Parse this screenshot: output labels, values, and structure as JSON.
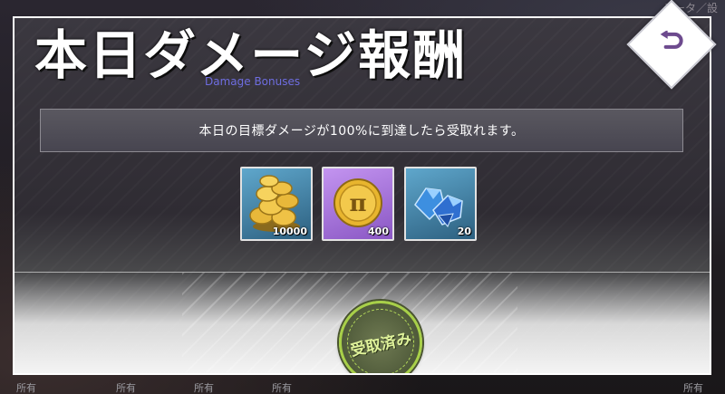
{
  "background": {
    "corner_text": "データ／設",
    "bottom_tabs": [
      "所有",
      "所有",
      "所有",
      "所有",
      "所有"
    ]
  },
  "modal": {
    "title": "本日ダメージ報酬",
    "subtitle": "Damage Bonuses",
    "notice": "本日の目標ダメージが100%に到達したら受取れます。",
    "back_button_icon": "return-arrow-icon",
    "rewards": [
      {
        "icon": "gold-coins-icon",
        "count": "10000"
      },
      {
        "icon": "pi-token-icon",
        "count": "400"
      },
      {
        "icon": "blue-gems-icon",
        "count": "20"
      }
    ],
    "claimed_stamp_label": "受取済み"
  },
  "colors": {
    "accent_subtitle": "#6e6de0",
    "stamp_green": "#a8d048",
    "back_icon": "#6d4a8e"
  }
}
